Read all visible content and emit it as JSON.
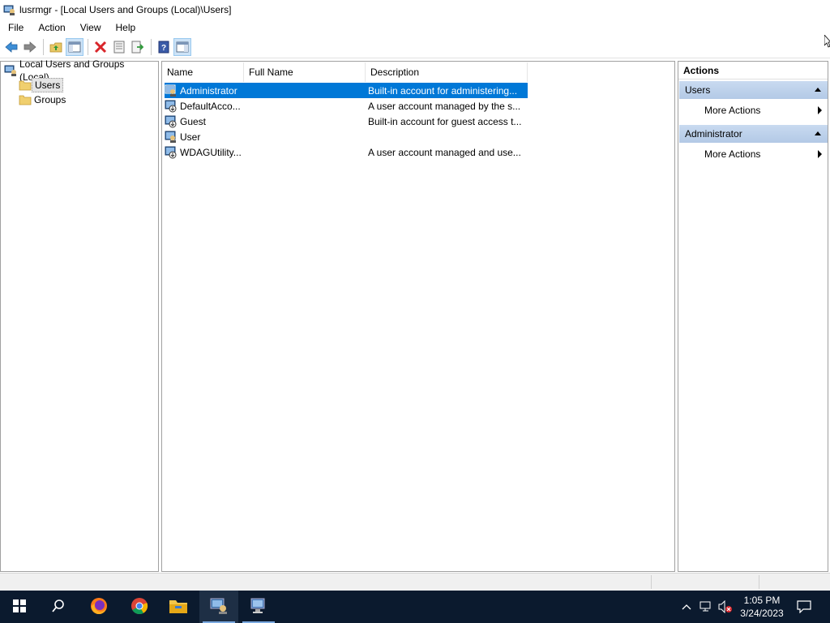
{
  "window": {
    "title": "lusrmgr - [Local Users and Groups (Local)\\Users]"
  },
  "menu": [
    "File",
    "Action",
    "View",
    "Help"
  ],
  "toolbar": {
    "buttons": [
      "back-icon",
      "forward-icon",
      "up-folder-icon",
      "show-hide-tree-icon",
      "delete-icon",
      "properties-icon",
      "export-list-icon",
      "help-icon",
      "show-hide-action-pane-icon"
    ]
  },
  "tree": {
    "root": "Local Users and Groups (Local)",
    "items": [
      {
        "label": "Users",
        "selected": true
      },
      {
        "label": "Groups",
        "selected": false
      }
    ]
  },
  "list": {
    "columns": [
      "Name",
      "Full Name",
      "Description"
    ],
    "rows": [
      {
        "name": "Administrator",
        "full_name": "",
        "description": "Built-in account for administering...",
        "selected": true
      },
      {
        "name": "DefaultAcco...",
        "full_name": "",
        "description": "A user account managed by the s...",
        "selected": false
      },
      {
        "name": "Guest",
        "full_name": "",
        "description": "Built-in account for guest access t...",
        "selected": false
      },
      {
        "name": "User",
        "full_name": "",
        "description": "",
        "selected": false
      },
      {
        "name": "WDAGUtility...",
        "full_name": "",
        "description": "A user account managed and use...",
        "selected": false
      }
    ]
  },
  "actions": {
    "title": "Actions",
    "groups": [
      {
        "header": "Users",
        "items": [
          "More Actions"
        ]
      },
      {
        "header": "Administrator",
        "items": [
          "More Actions"
        ]
      }
    ]
  },
  "taskbar": {
    "apps": [
      "start-icon",
      "search-icon",
      "firefox-icon",
      "chrome-icon",
      "file-explorer-icon",
      "lusrmgr-icon",
      "computer-management-icon"
    ],
    "tray": [
      "chevron-up-icon",
      "network-icon",
      "volume-muted-icon",
      "notifications-icon"
    ],
    "time": "1:05 PM",
    "date": "3/24/2023"
  },
  "colors": {
    "selection": "#0078d7",
    "action_header": "#c4d6ee",
    "taskbar": "#0b1a2e"
  }
}
